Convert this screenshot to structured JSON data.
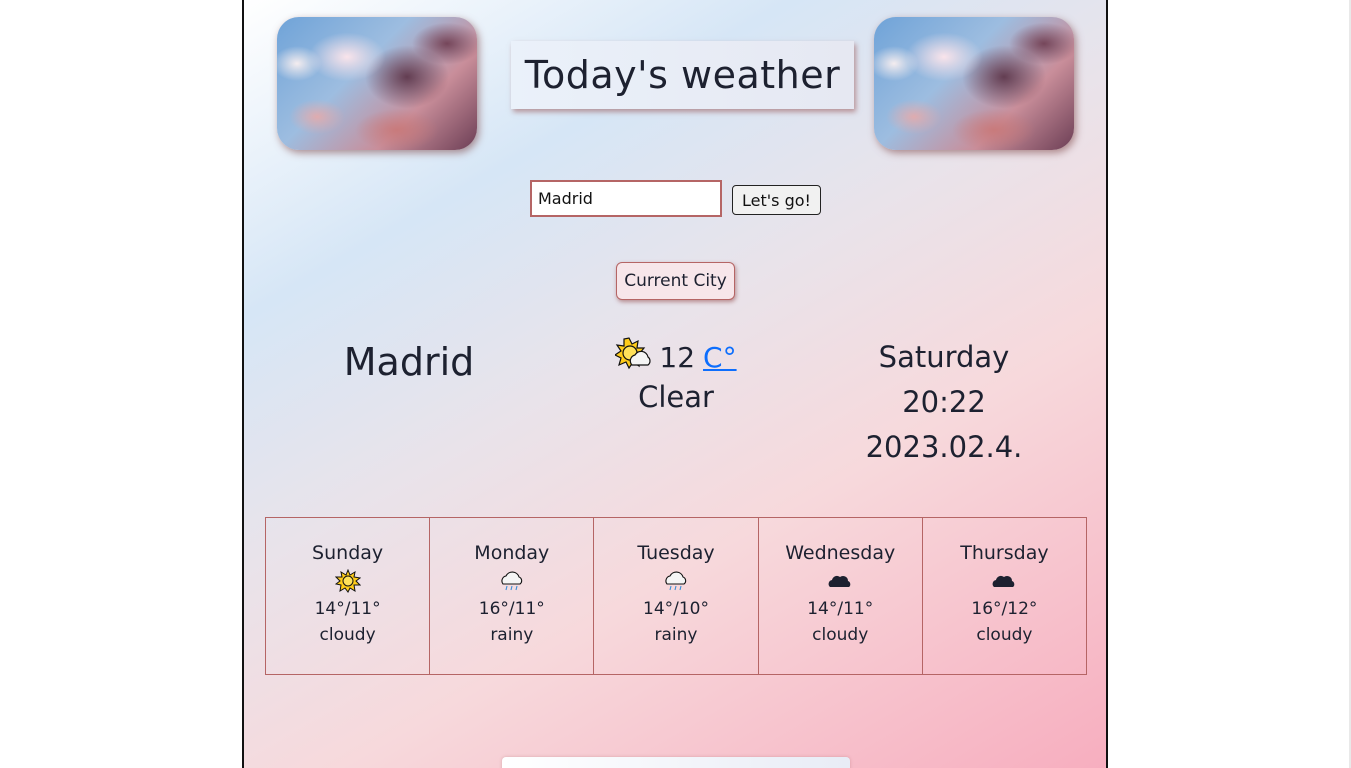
{
  "header": {
    "title": "Today's weather"
  },
  "search": {
    "value": "Madrid",
    "button_label": "Let's go!"
  },
  "current_city_button": "Current City",
  "current": {
    "city": "Madrid",
    "icon": "sun-behind-cloud-icon",
    "temperature": "12",
    "unit": "C°",
    "condition": "Clear",
    "day": "Saturday",
    "time": "20:22",
    "date": "2023.02.4."
  },
  "forecast": [
    {
      "day": "Sunday",
      "icon": "sun-icon",
      "temps": "14°/11°",
      "desc": "cloudy"
    },
    {
      "day": "Monday",
      "icon": "rain-cloud-icon",
      "temps": "16°/11°",
      "desc": "rainy"
    },
    {
      "day": "Tuesday",
      "icon": "rain-cloud-icon",
      "temps": "14°/10°",
      "desc": "rainy"
    },
    {
      "day": "Wednesday",
      "icon": "cloud-icon",
      "temps": "14°/11°",
      "desc": "cloudy"
    },
    {
      "day": "Thursday",
      "icon": "cloud-icon",
      "temps": "16°/12°",
      "desc": "cloudy"
    }
  ]
}
